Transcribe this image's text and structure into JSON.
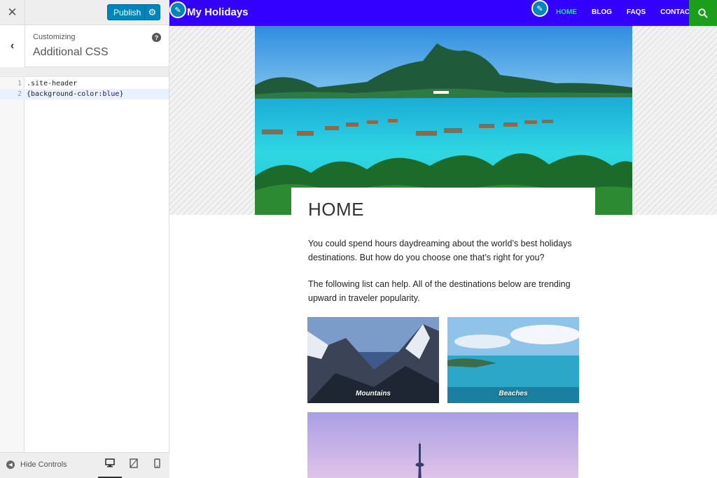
{
  "customizer": {
    "close_icon": "close-icon",
    "publish_label": "Publish",
    "section_caption": "Customizing",
    "section_title": "Additional CSS",
    "help_label": "?",
    "editor_lines": [
      {
        "num": "1",
        "code": ".site-header"
      },
      {
        "num": "2",
        "code_open": "{background-color:",
        "code_value": "blue",
        "code_close": "}"
      }
    ],
    "hide_controls_label": "Hide Controls",
    "device_buttons": [
      "desktop",
      "tablet",
      "mobile"
    ]
  },
  "site": {
    "title": "My Holidays",
    "header_color": "#3300ff",
    "nav": [
      {
        "label": "HOME",
        "current": true
      },
      {
        "label": "BLOG"
      },
      {
        "label": "FAQS"
      },
      {
        "label": "CONTACT"
      }
    ],
    "page_title": "HOME",
    "paragraphs": [
      "You could spend hours daydreaming about the world’s best holidays destinations. But how do you choose one that’s right for you?",
      "The following list can help. All of the destinations below are trending upward in traveler popularity."
    ],
    "tiles": [
      "Mountains",
      "Beaches"
    ]
  },
  "colors": {
    "accent": "#0085ba",
    "nav_current": "#22d8a9",
    "search_bg": "#1b9e1b"
  }
}
